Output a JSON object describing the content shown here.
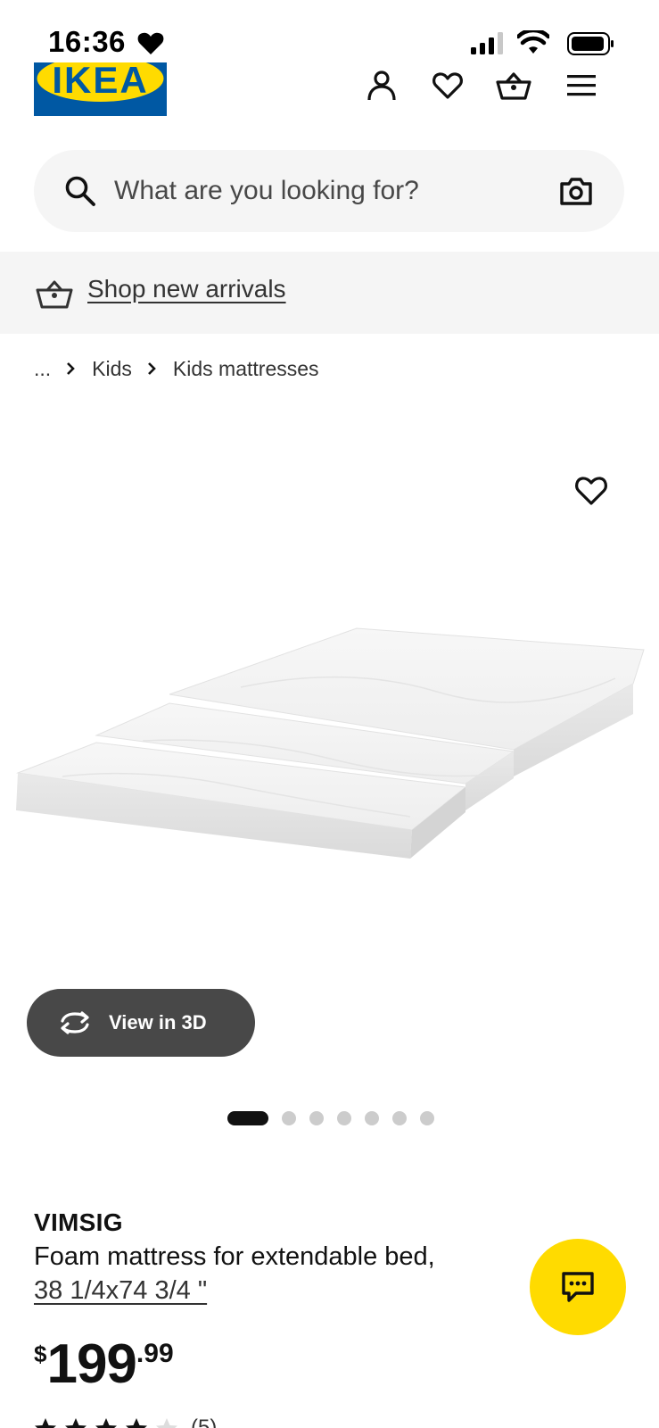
{
  "status_bar": {
    "time": "16:36"
  },
  "header": {
    "logo_text": "IKEA",
    "icons": [
      "user-icon",
      "heart-icon",
      "basket-icon",
      "menu-icon"
    ]
  },
  "search": {
    "placeholder": "What are you looking for?"
  },
  "promo": {
    "label": "Shop new arrivals"
  },
  "breadcrumb": {
    "ellipsis": "...",
    "items": [
      "Kids",
      "Kids mattresses"
    ]
  },
  "gallery": {
    "view3d_label": "View in 3D",
    "slide_count": 7,
    "active_slide": 1
  },
  "product": {
    "name": "VIMSIG",
    "description": "Foam mattress for extendable bed,",
    "size": "38 1/4x74 3/4 \"",
    "price": {
      "currency": "$",
      "integer": "199",
      "decimal": ".99"
    },
    "rating": {
      "stars": 4,
      "max_stars": 5,
      "count": "(5)"
    }
  },
  "colors": {
    "ikea_blue": "#0058a3",
    "ikea_yellow": "#ffdb00",
    "view3d_bg": "#484848",
    "search_bg": "#f5f5f5"
  }
}
